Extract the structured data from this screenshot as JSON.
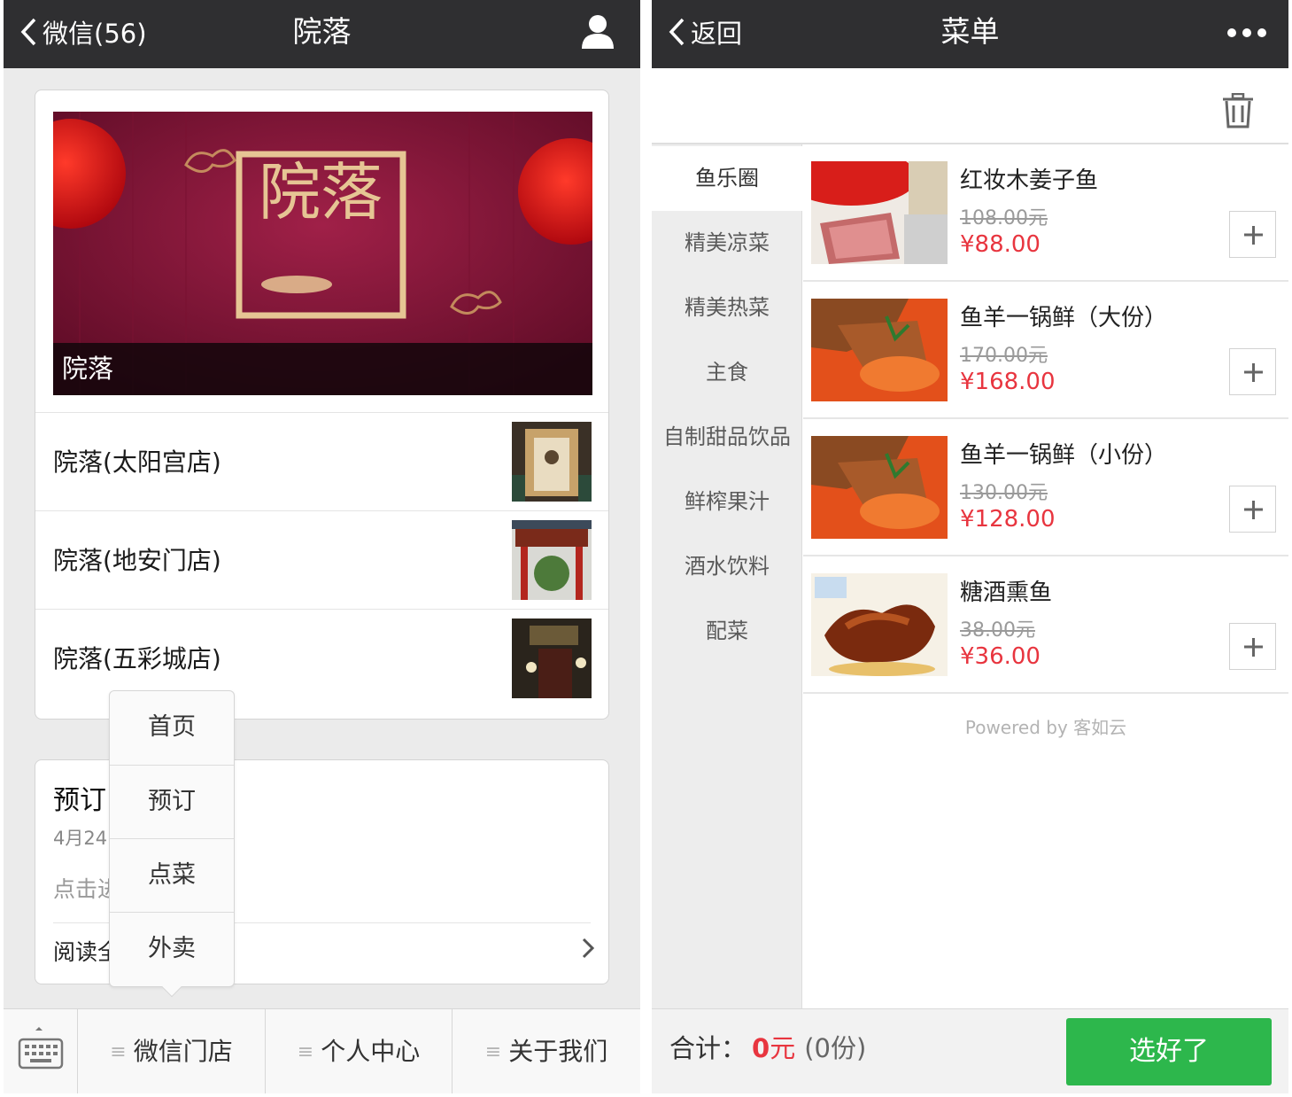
{
  "left": {
    "nav": {
      "back_label": "微信(56)",
      "title": "院落"
    },
    "banner": {
      "caption": "院落",
      "logo_text": "院落"
    },
    "stores": [
      {
        "name": "院落(太阳宫店)"
      },
      {
        "name": "院落(地安门店)"
      },
      {
        "name": "院落(五彩城店)"
      }
    ],
    "reservation": {
      "title": "预订",
      "date": "4月24",
      "desc": "点击进",
      "read_label": "阅读全"
    },
    "popup_menu": [
      "首页",
      "预订",
      "点菜",
      "外卖"
    ],
    "bottom_menu": [
      "微信门店",
      "个人中心",
      "关于我们"
    ]
  },
  "right": {
    "nav": {
      "back_label": "返回",
      "title": "菜单"
    },
    "categories": [
      "鱼乐圈",
      "精美凉菜",
      "精美热菜",
      "主食",
      "自制甜品饮品",
      "鲜榨果汁",
      "酒水饮料",
      "配菜"
    ],
    "active_category": "鱼乐圈",
    "dishes": [
      {
        "name": "红妆木姜子鱼",
        "old_price": "108.00元",
        "price": "¥88.00"
      },
      {
        "name": "鱼羊一锅鲜（大份）",
        "old_price": "170.00元",
        "price": "¥168.00"
      },
      {
        "name": "鱼羊一锅鲜（小份）",
        "old_price": "130.00元",
        "price": "¥128.00"
      },
      {
        "name": "糖酒熏鱼",
        "old_price": "38.00元",
        "price": "¥36.00"
      }
    ],
    "powered_by": "Powered by 客如云",
    "cart": {
      "label": "合计：",
      "total": "0",
      "total_unit": "元",
      "count": "(0份)",
      "confirm": "选好了"
    }
  },
  "colors": {
    "navbar": "#2f2f31",
    "price_red": "#e8353f",
    "confirm_green": "#2db74c",
    "banner_red": "#8c1638"
  }
}
